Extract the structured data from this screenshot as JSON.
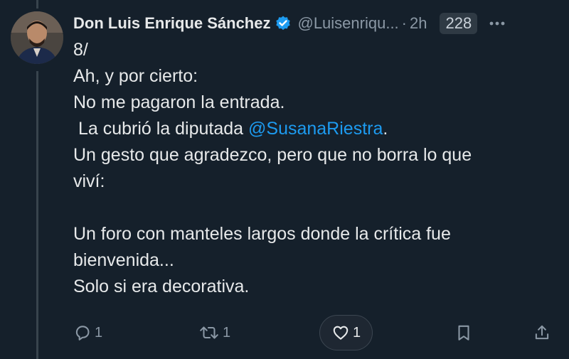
{
  "author": {
    "name": "Don Luis Enrique Sánchez",
    "handle": "@Luisenriqu...",
    "separator": "·",
    "time": "2h",
    "view_badge": "228"
  },
  "post": {
    "line1": "8/",
    "line2": "Ah, y por cierto:",
    "line3": "No me pagaron la entrada.",
    "line4_prefix": " La cubrió la diputada ",
    "line4_mention": "@SusanaRiestra",
    "line4_suffix": ".",
    "line5": "Un gesto que agradezco, pero que no borra lo que",
    "line6": "viví:",
    "line8": "Un foro con manteles largos donde la crítica fue",
    "line9": "bienvenida...",
    "line10": "Solo si era decorativa."
  },
  "actions": {
    "reply_count": "1",
    "repost_count": "1",
    "like_count": "1"
  },
  "icons": {
    "verified": "verified-badge-icon",
    "more": "more-options-icon",
    "reply": "reply-icon",
    "repost": "repost-icon",
    "like": "heart-icon",
    "bookmark": "bookmark-icon",
    "share": "share-icon"
  },
  "colors": {
    "background": "#15202b",
    "text": "#e7e9ea",
    "muted": "#8b98a5",
    "mention": "#1d9bf0",
    "verified": "#1d9bf0"
  }
}
